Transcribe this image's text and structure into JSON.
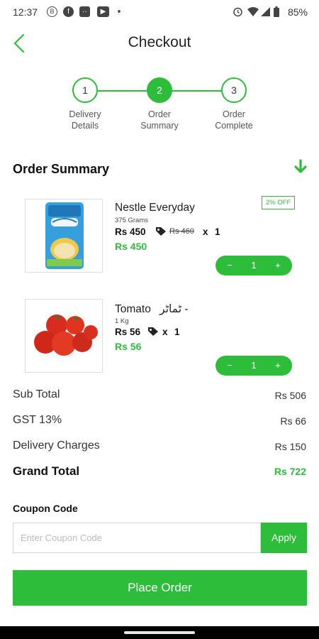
{
  "status_bar": {
    "time": "12:37",
    "battery": "85%",
    "icons": [
      "b-circle-icon",
      "facebook-icon",
      "messenger-icon",
      "youtube-icon",
      "dot-icon",
      "alarm-icon",
      "wifi-icon",
      "signal-icon",
      "battery-icon"
    ]
  },
  "header": {
    "title": "Checkout",
    "back_icon": "chevron-left-icon"
  },
  "stepper": {
    "steps": [
      {
        "number": "1",
        "label_line1": "Delivery",
        "label_line2": "Details",
        "active": false
      },
      {
        "number": "2",
        "label_line1": "Order",
        "label_line2": "Summary",
        "active": true
      },
      {
        "number": "3",
        "label_line1": "Order",
        "label_line2": "Complete",
        "active": false
      }
    ]
  },
  "order_summary": {
    "title": "Order Summary",
    "toggle_icon": "arrow-down-icon",
    "items": [
      {
        "name": "Nestle Everyday",
        "weight": "375 Grams",
        "price": "Rs 450",
        "original_price": "Rs 460",
        "multiplier": "x",
        "quantity_label": "1",
        "total": "Rs 450",
        "badge": "2% OFF",
        "quantity": "1",
        "decrement": "−",
        "increment": "+"
      },
      {
        "name": "Tomato",
        "name_urdu": "ٹماٹر -",
        "weight": "1 Kg",
        "price": "Rs 56",
        "multiplier": "x",
        "quantity_label": "1",
        "total": "Rs 56",
        "quantity": "1",
        "decrement": "−",
        "increment": "+"
      }
    ]
  },
  "totals": {
    "sub_total_label": "Sub Total",
    "sub_total_value": "Rs 506",
    "gst_label": "GST 13%",
    "gst_value": "Rs 66",
    "delivery_label": "Delivery Charges",
    "delivery_value": "Rs 150",
    "grand_label": "Grand Total",
    "grand_value": "Rs 722"
  },
  "coupon": {
    "title": "Coupon Code",
    "placeholder": "Enter Coupon Code",
    "value": "",
    "apply_label": "Apply"
  },
  "place_order_label": "Place Order",
  "colors": {
    "accent": "#2dbd3a",
    "text": "#111111"
  }
}
